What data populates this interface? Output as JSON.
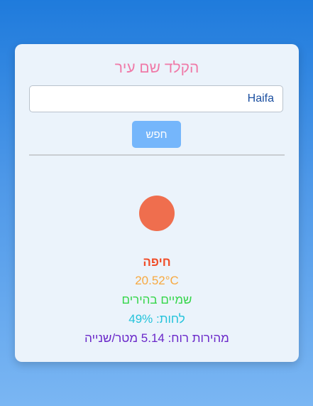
{
  "search": {
    "title": "הקלד שם עיר",
    "input_value": "Haifa",
    "button_label": "חפש"
  },
  "weather": {
    "icon": "sun-icon",
    "icon_color": "#ef6e4e",
    "city": "חיפה",
    "temperature": "20.52°C",
    "description": "שמיים בהירים",
    "humidity": "לחות: 49%",
    "wind": "מהירות רוח: 5.14 מטר/שנייה"
  }
}
